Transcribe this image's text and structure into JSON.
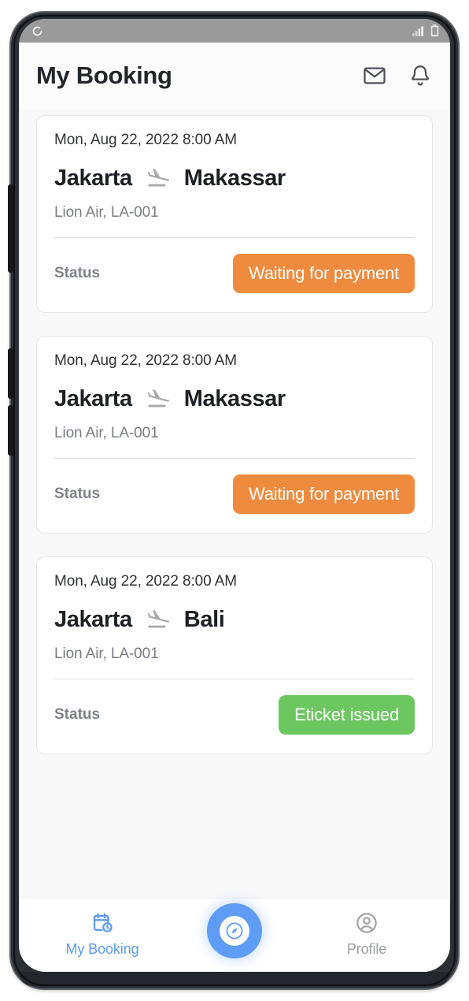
{
  "status_bar": {
    "left_icon": "loading-spinner-icon",
    "signal_icon": "signal-bars-icon",
    "battery_icon": "battery-icon"
  },
  "header": {
    "title": "My Booking",
    "mail_icon": "mail-icon",
    "bell_icon": "bell-icon"
  },
  "labels": {
    "status": "Status",
    "route_icon": "flight-takeoff-icon"
  },
  "colors": {
    "accent_blue": "#5e9cf6",
    "status_orange": "#ee8b3f",
    "status_green": "#6cc761",
    "page_bg": "#f8f8f9",
    "card_bg": "#ffffff"
  },
  "bookings": [
    {
      "date": "Mon, Aug 22, 2022 8:00 AM",
      "origin": "Jakarta",
      "destination": "Makassar",
      "airline": "Lion Air, LA-001",
      "status_label": "Status",
      "status_value": "Waiting for payment",
      "status_color": "#ee8b3f"
    },
    {
      "date": "Mon, Aug 22, 2022 8:00 AM",
      "origin": "Jakarta",
      "destination": "Makassar",
      "airline": "Lion Air, LA-001",
      "status_label": "Status",
      "status_value": "Waiting for payment",
      "status_color": "#ee8b3f"
    },
    {
      "date": "Mon, Aug 22, 2022 8:00 AM",
      "origin": "Jakarta",
      "destination": "Bali",
      "airline": "Lion Air, LA-001",
      "status_label": "Status",
      "status_value": "Eticket issued",
      "status_color": "#6cc761"
    }
  ],
  "bottom_nav": {
    "items": [
      {
        "label": "My Booking",
        "icon": "calendar-clock-icon",
        "active": true
      },
      {
        "label": "Profile",
        "icon": "profile-circle-icon",
        "active": false
      }
    ],
    "fab_icon": "compass-icon"
  }
}
